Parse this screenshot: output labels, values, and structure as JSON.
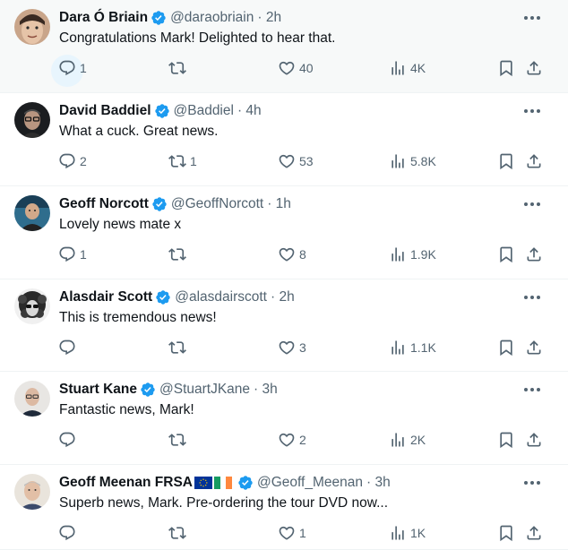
{
  "colors": {
    "verified": "#1d9bf0",
    "meta_text": "#536471",
    "text": "#0f1419",
    "divider": "#eff3f4"
  },
  "tweets": [
    {
      "name": "Dara Ó Briain",
      "handle": "@daraobriain",
      "time": "· 2h",
      "text": "Congratulations Mark! Delighted to hear that.",
      "replies": "1",
      "retweets": "",
      "likes": "40",
      "views": "4K",
      "highlighted": true
    },
    {
      "name": "David Baddiel",
      "handle": "@Baddiel",
      "time": "· 4h",
      "text": "What a cuck. Great news.",
      "replies": "2",
      "retweets": "1",
      "likes": "53",
      "views": "5.8K"
    },
    {
      "name": "Geoff Norcott",
      "handle": "@GeoffNorcott",
      "time": "· 1h",
      "text": "Lovely news mate x",
      "replies": "1",
      "retweets": "",
      "likes": "8",
      "views": "1.9K"
    },
    {
      "name": "Alasdair Scott",
      "handle": "@alasdairscott",
      "time": "· 2h",
      "text": "This is tremendous news!",
      "replies": "",
      "retweets": "",
      "likes": "3",
      "views": "1.1K"
    },
    {
      "name": "Stuart Kane",
      "handle": "@StuartJKane",
      "time": "· 3h",
      "text": "Fantastic news, Mark!",
      "replies": "",
      "retweets": "",
      "likes": "2",
      "views": "2K"
    },
    {
      "name": "Geoff Meenan FRSA",
      "flags": [
        "EU",
        "IE"
      ],
      "handle": "@Geoff_Meenan",
      "time": "· 3h",
      "text": "Superb news, Mark. Pre-ordering the tour DVD now...",
      "replies": "",
      "retweets": "",
      "likes": "1",
      "views": "1K"
    }
  ]
}
